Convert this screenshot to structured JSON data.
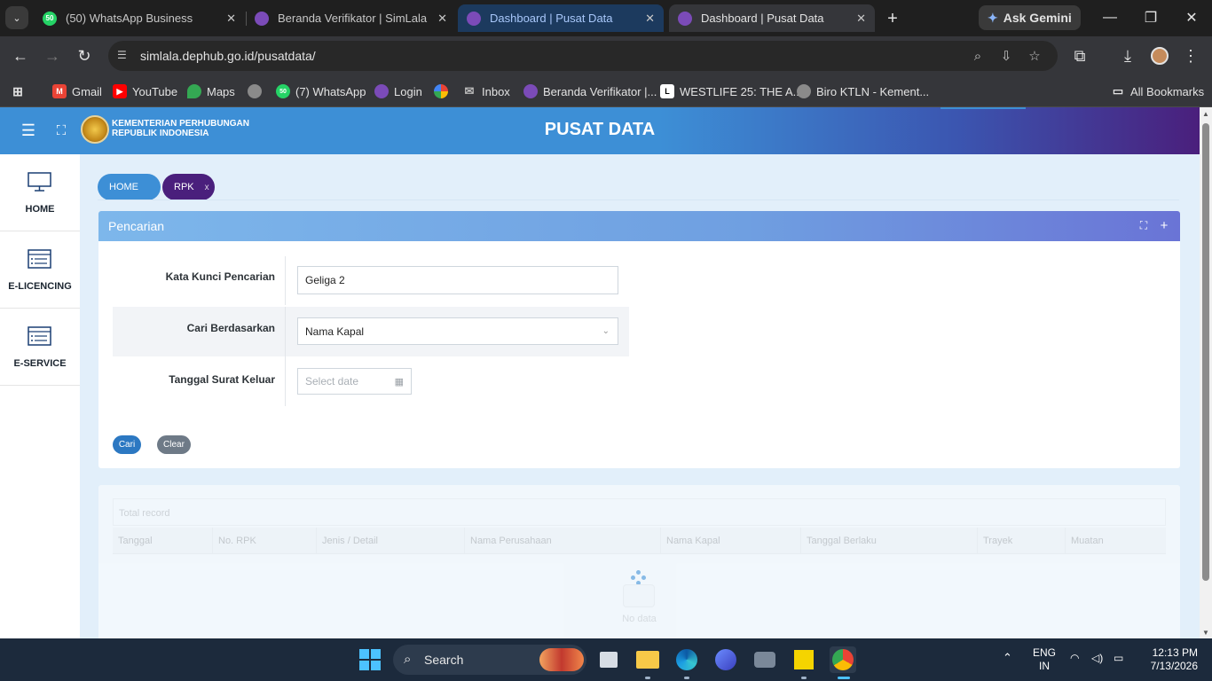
{
  "browser": {
    "tabs": [
      {
        "badge": "50",
        "title": "(50) WhatsApp Business"
      },
      {
        "title": "Beranda Verifikator | SimLala"
      },
      {
        "title": "Dashboard | Pusat Data"
      },
      {
        "title": "Dashboard | Pusat Data"
      }
    ],
    "gemini_label": "Ask Gemini",
    "url": "simlala.dephub.go.id/pusatdata/",
    "bookmarks": [
      {
        "label": "Gmail",
        "icon": "gmail-icon"
      },
      {
        "label": "YouTube",
        "icon": "youtube-icon"
      },
      {
        "label": "Maps",
        "icon": "maps-icon"
      },
      {
        "label": "",
        "icon": "globe-icon"
      },
      {
        "label": "(7) WhatsApp",
        "icon": "whatsapp-icon",
        "badge": "50"
      },
      {
        "label": "Login",
        "icon": "site-icon"
      },
      {
        "label": "",
        "icon": "pinwheel-icon"
      },
      {
        "label": "Inbox",
        "icon": "mail-icon"
      },
      {
        "label": "Beranda Verifikator |...",
        "icon": "site-icon"
      },
      {
        "label": "WESTLIFE 25: THE A...",
        "icon": "letter-l-icon"
      },
      {
        "label": "Biro KTLN - Kement...",
        "icon": "globe-icon"
      }
    ],
    "all_bookmarks": "All Bookmarks"
  },
  "app": {
    "ministry_line1": "KEMENTERIAN PERHUBUNGAN",
    "ministry_line2": "REPUBLIK INDONESIA",
    "title": "PUSAT DATA",
    "sidebar": [
      {
        "label": "HOME",
        "icon": "monitor-icon"
      },
      {
        "label": "E-LICENCING",
        "icon": "list-card-icon"
      },
      {
        "label": "E-SERVICE",
        "icon": "list-card-icon"
      }
    ],
    "breadcrumbs": {
      "home": "HOME",
      "current": "RPK",
      "close": "x"
    },
    "panel": {
      "title": "Pencarian",
      "fields": {
        "keyword_label": "Kata Kunci Pencarian",
        "keyword_value": "Geliga 2",
        "search_by_label": "Cari Berdasarkan",
        "search_by_value": "Nama Kapal",
        "date_label": "Tanggal Surat Keluar",
        "date_placeholder": "Select date"
      },
      "buttons": {
        "search": "Cari",
        "clear": "Clear"
      }
    },
    "results": {
      "total_label": "Total record",
      "columns": [
        "Tanggal",
        "No. RPK",
        "Jenis / Detail",
        "Nama Perusahaan",
        "Nama Kapal",
        "Tanggal Berlaku",
        "Trayek",
        "Muatan"
      ],
      "empty_text": "No data"
    }
  },
  "taskbar": {
    "search_label": "Search",
    "lang_line1": "ENG",
    "lang_line2": "IN",
    "time": "12:13 PM",
    "date": "7/13/2026"
  },
  "colors": {
    "header_start": "#3d8fd6",
    "header_end": "#4a1f7c",
    "breadcrumb_home": "#3d8fd6",
    "breadcrumb_active": "#4a1f7c",
    "button_search": "#2c78c2",
    "button_clear": "#6e7a87"
  }
}
